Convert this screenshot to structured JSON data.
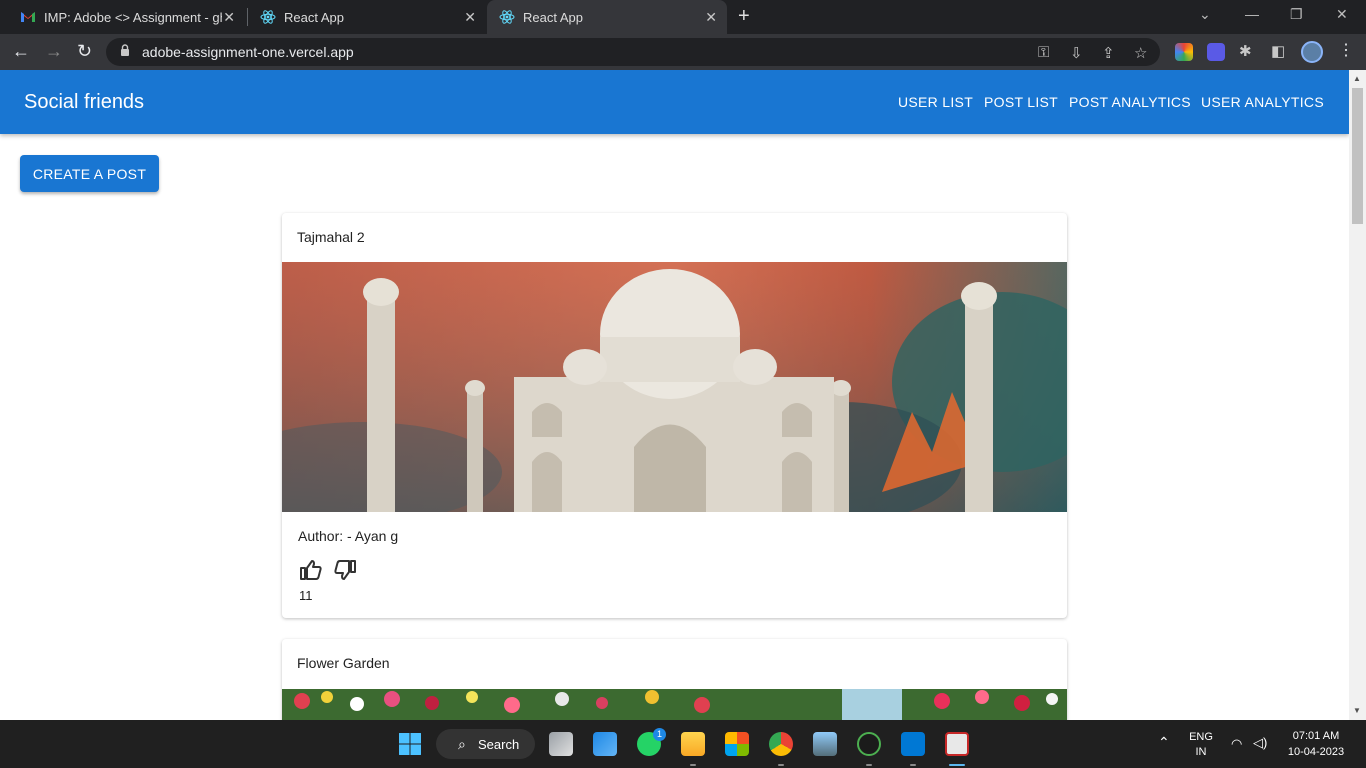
{
  "browser": {
    "tabs": [
      {
        "title": "IMP: Adobe <> Assignment - gh",
        "icon": "gmail-icon"
      },
      {
        "title": "React App",
        "icon": "react-icon"
      },
      {
        "title": "React App",
        "icon": "react-icon"
      }
    ],
    "url": "adobe-assignment-one.vercel.app"
  },
  "app": {
    "brand": "Social friends",
    "nav": [
      "USER LIST",
      "POST LIST",
      "POST ANALYTICS",
      "USER ANALYTICS"
    ],
    "create_button": "CREATE A POST",
    "accent_color": "#1976d2"
  },
  "posts": [
    {
      "title": "Tajmahal 2",
      "author": "Author: - Ayan g",
      "likes": "11",
      "image": "taj-mahal-photo"
    },
    {
      "title": "Flower Garden",
      "image": "flower-garden-photo"
    }
  ],
  "taskbar": {
    "search_label": "Search",
    "whatsapp_badge": "1",
    "lang": "ENG",
    "region": "IN",
    "time": "07:01 AM",
    "date": "10-04-2023"
  }
}
